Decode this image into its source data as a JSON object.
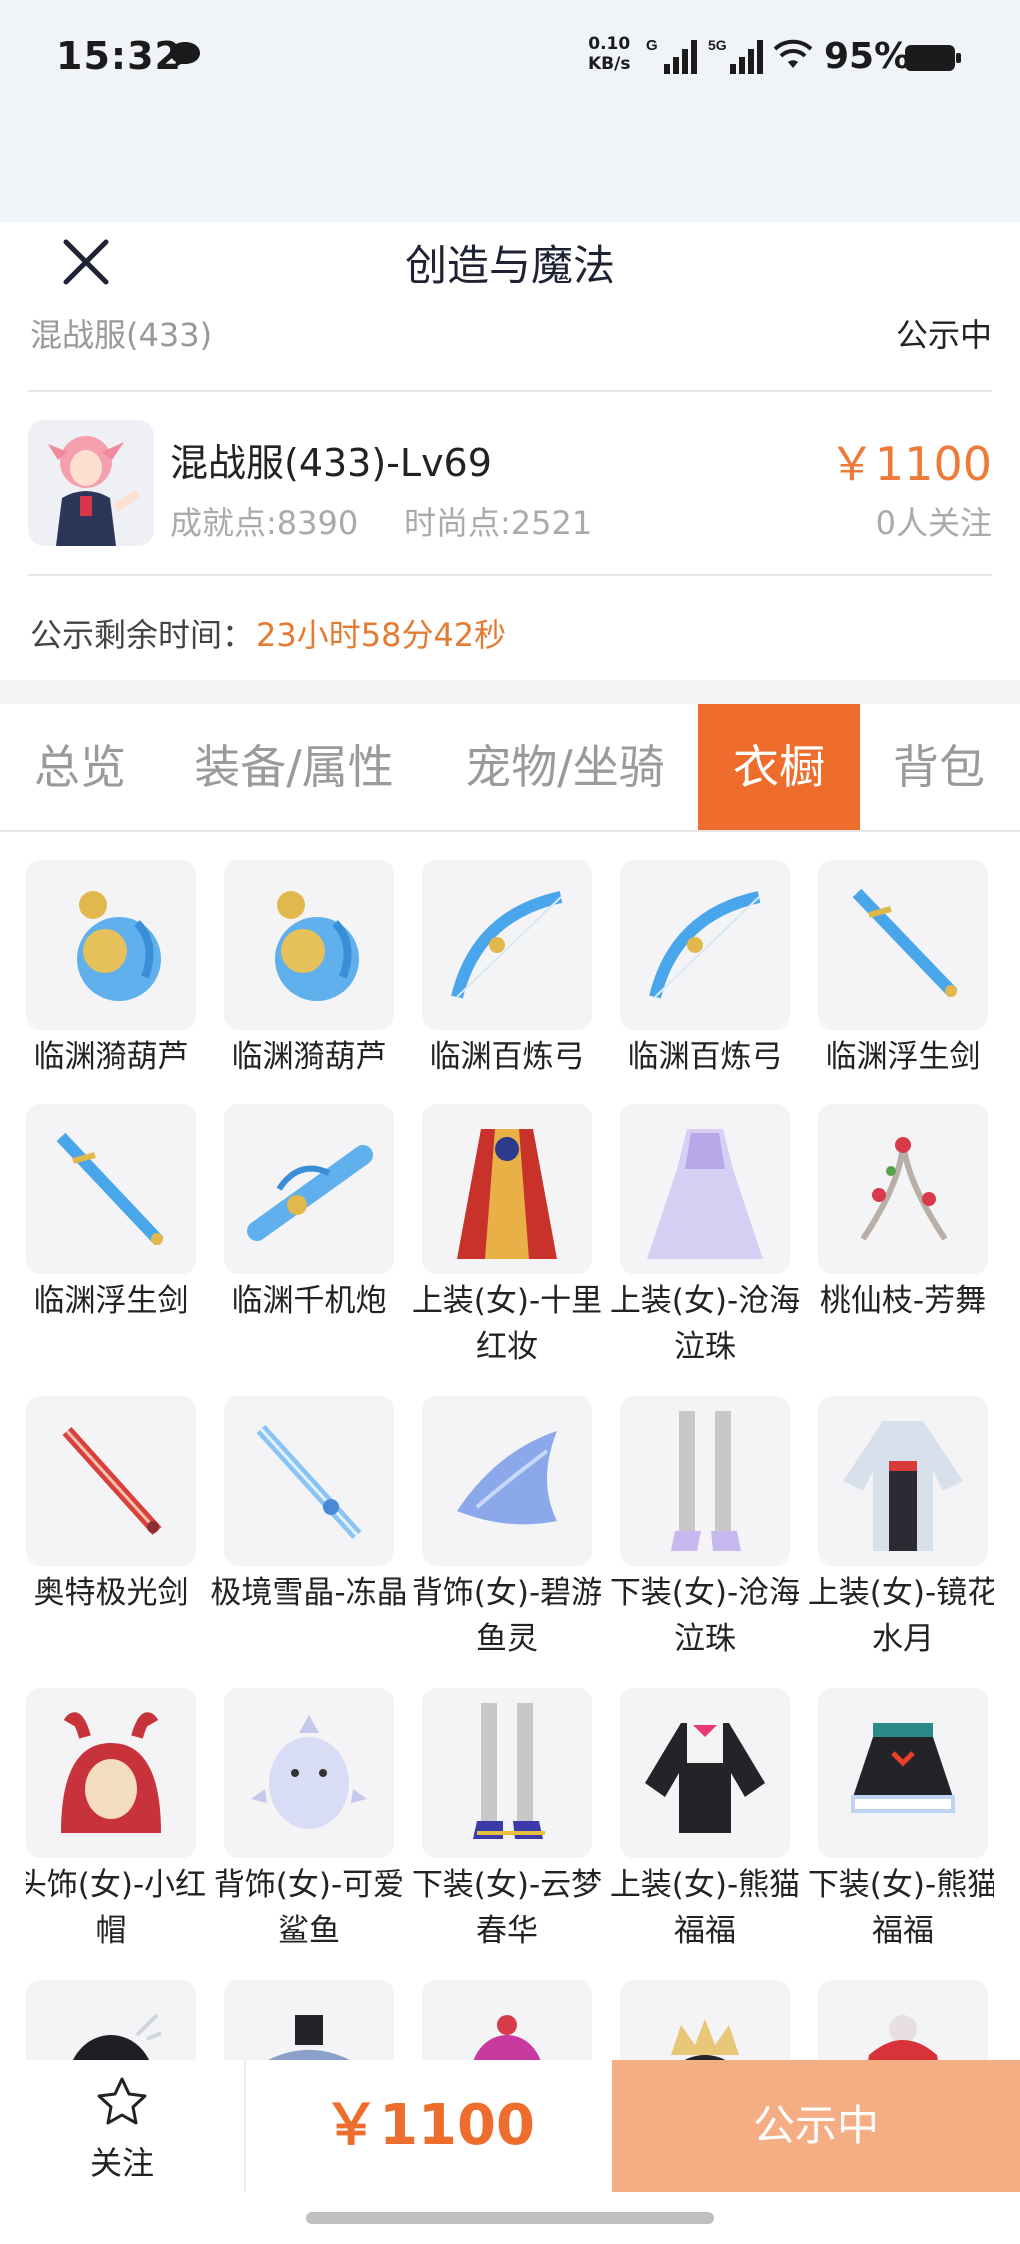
{
  "status_bar": {
    "time": "15:32",
    "net_speed_value": "0.10",
    "net_speed_unit": "KB/s",
    "sim1_label": "G",
    "sim2_label": "5G",
    "battery": "95%"
  },
  "nav": {
    "title": "创造与魔法"
  },
  "account": {
    "server": "混战服(433)",
    "status": "公示中",
    "char_name": "混战服(433)-Lv69",
    "achievement": "成就点:8390",
    "fashion": "时尚点:2521",
    "price": "￥1100",
    "followers": "0人关注",
    "timer_label": "公示剩余时间：",
    "timer_value": "23小时58分42秒"
  },
  "tabs": [
    "总览",
    "装备/属性",
    "宠物/坐骑",
    "衣橱",
    "背包"
  ],
  "items": [
    {
      "label": "临渊漪葫芦",
      "icon": "gourd-icon"
    },
    {
      "label": "临渊漪葫芦",
      "icon": "gourd-icon"
    },
    {
      "label": "临渊百炼弓",
      "icon": "bow-icon"
    },
    {
      "label": "临渊百炼弓",
      "icon": "bow-icon"
    },
    {
      "label": "临渊浮生剑",
      "icon": "sword-icon"
    },
    {
      "label": "临渊浮生剑",
      "icon": "sword-icon"
    },
    {
      "label": "临渊千机炮",
      "icon": "cannon-icon"
    },
    {
      "label": "上装(女)-十里红妆",
      "icon": "robe-icon"
    },
    {
      "label": "上装(女)-沧海泣珠",
      "icon": "dress-icon"
    },
    {
      "label": "桃仙枝-芳舞",
      "icon": "branch-icon"
    },
    {
      "label": "奥特极光剑",
      "icon": "red-sword-icon"
    },
    {
      "label": "极境雪晶-冻晶",
      "icon": "ice-sword-icon"
    },
    {
      "label": "背饰(女)-碧游鱼灵",
      "icon": "fish-wing-icon"
    },
    {
      "label": "下装(女)-沧海泣珠",
      "icon": "legs-icon"
    },
    {
      "label": "上装(女)-镜花水月",
      "icon": "kimono-icon"
    },
    {
      "label": "头饰(女)-小红帽",
      "icon": "hood-icon"
    },
    {
      "label": "背饰(女)-可爱鲨鱼",
      "icon": "shark-icon"
    },
    {
      "label": "下装(女)-云梦春华",
      "icon": "boots-icon"
    },
    {
      "label": "上装(女)-熊猫福福",
      "icon": "panda-top-icon"
    },
    {
      "label": "下装(女)-熊猫福福",
      "icon": "panda-skirt-icon"
    },
    {
      "label": "",
      "icon": "hair-icon"
    },
    {
      "label": "",
      "icon": "hat-icon"
    },
    {
      "label": "",
      "icon": "cupcake-icon"
    },
    {
      "label": "",
      "icon": "crown-icon"
    },
    {
      "label": "",
      "icon": "red-outfit-icon"
    }
  ],
  "bottom": {
    "follow_label": "关注",
    "price": "￥1100",
    "action": "公示中"
  },
  "colors": {
    "accent": "#ee6c2c",
    "accent_light": "#f5ae84"
  }
}
